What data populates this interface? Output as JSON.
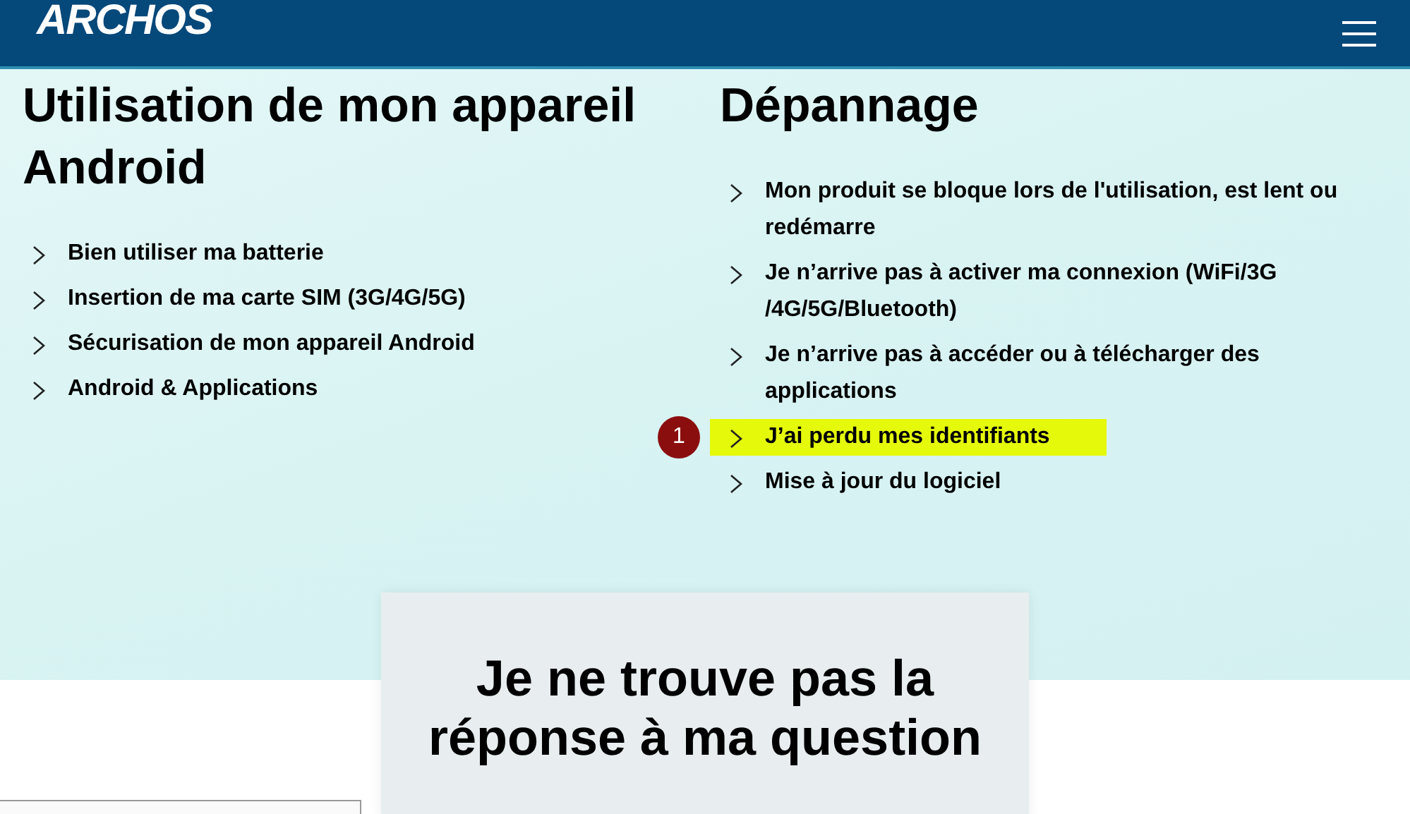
{
  "header": {
    "logo": "ARCHOS"
  },
  "sections": [
    {
      "title": "Utilisation de mon appareil Android",
      "items": [
        {
          "label": "Bien utiliser ma batterie",
          "highlighted": false
        },
        {
          "label": "Insertion de ma carte SIM (3G/4G/5G)",
          "highlighted": false
        },
        {
          "label": "Sécurisation de mon appareil Android",
          "highlighted": false
        },
        {
          "label": "Android & Applications",
          "highlighted": false
        }
      ]
    },
    {
      "title": "Dépannage",
      "items": [
        {
          "label": "Mon produit se bloque lors de l'utilisation, est lent ou redémarre",
          "highlighted": false
        },
        {
          "label": "Je n’arrive pas à activer ma connexion (WiFi/3G /4G/5G/Bluetooth)",
          "highlighted": false
        },
        {
          "label": "Je n’arrive pas à accéder ou à télécharger des applications",
          "highlighted": false
        },
        {
          "label": "J’ai perdu mes identifiants",
          "highlighted": true,
          "badge": "1"
        },
        {
          "label": "Mise à jour du logiciel",
          "highlighted": false
        }
      ]
    }
  ],
  "card": {
    "title": "Je ne trouve pas la réponse à ma question"
  }
}
